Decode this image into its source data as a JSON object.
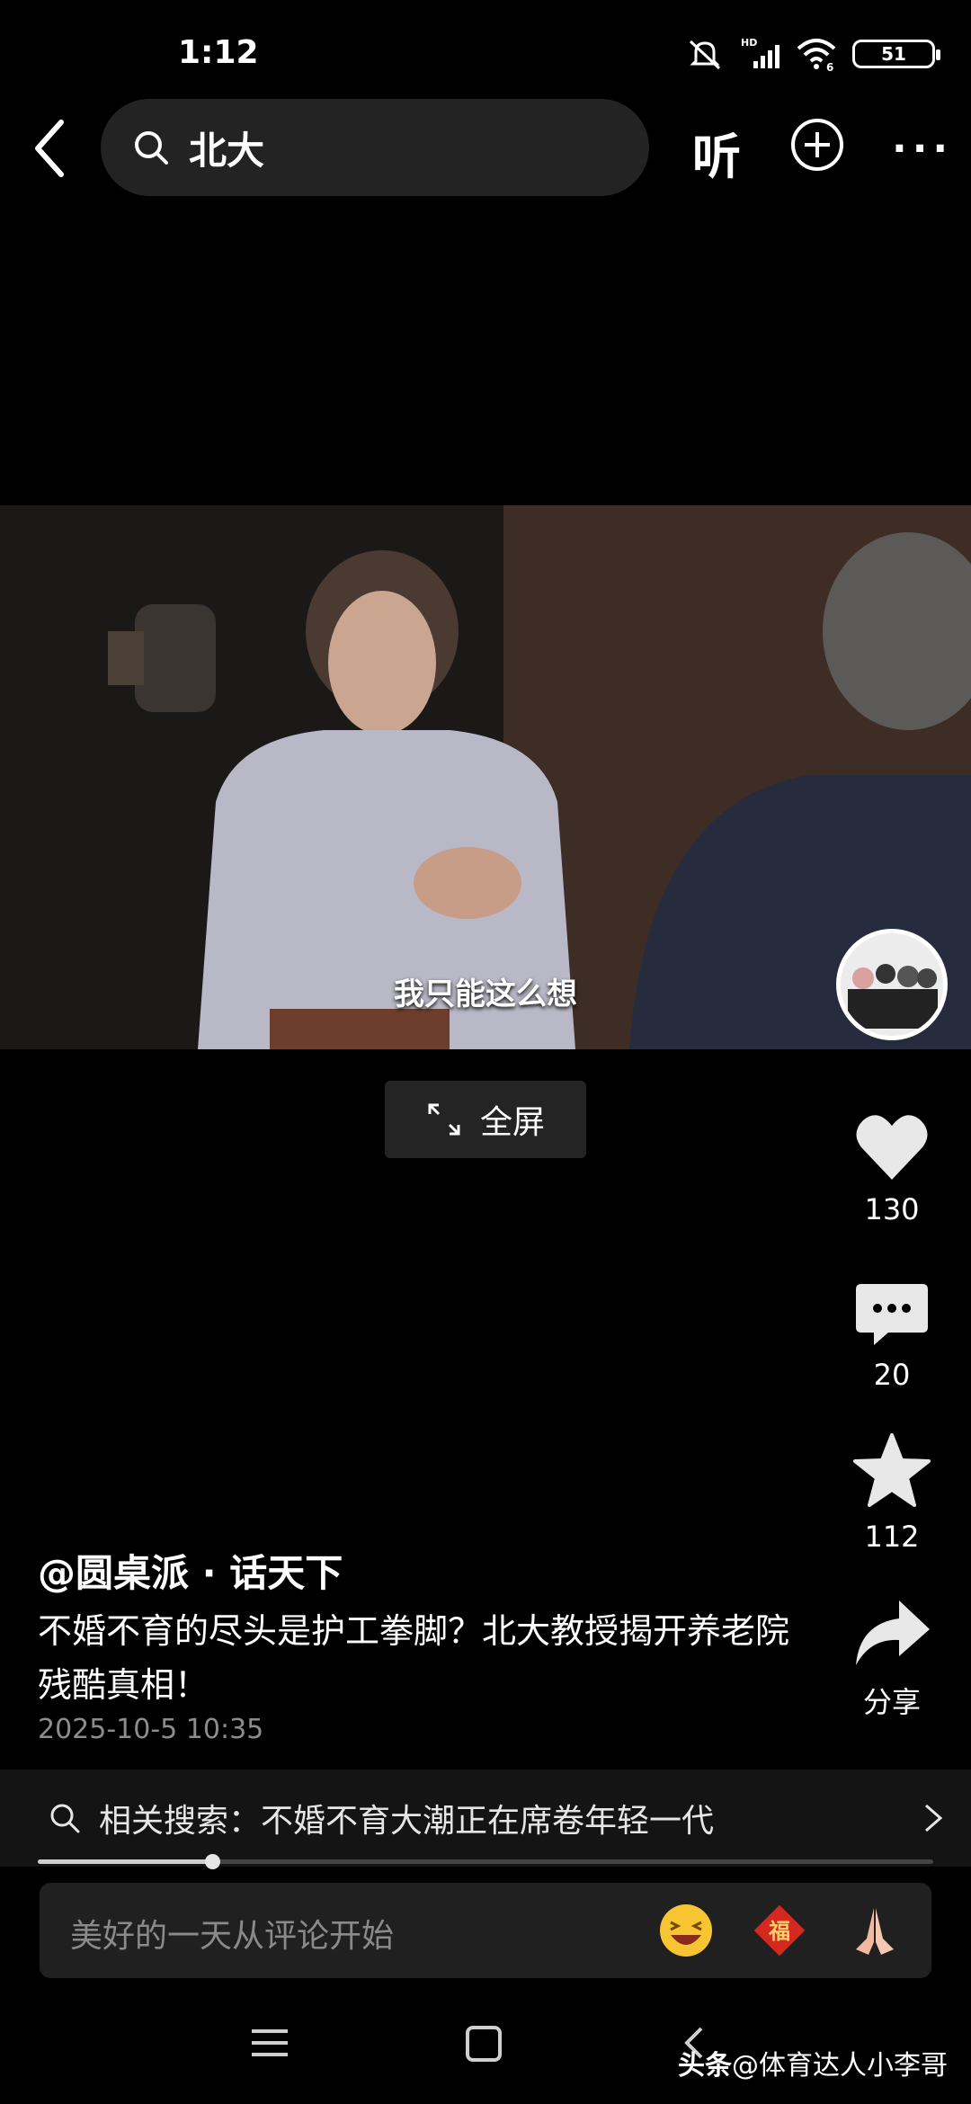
{
  "status_bar": {
    "time": "1:12",
    "network": "HD",
    "signal_sub": "6",
    "battery": "51"
  },
  "header": {
    "search_text": "北大",
    "listen_label": "听"
  },
  "video": {
    "subtitle": "我只能这么想"
  },
  "fullscreen_label": "全屏",
  "actions": {
    "likes": "130",
    "comments": "20",
    "favorites": "112",
    "share_label": "分享"
  },
  "post": {
    "author": "@圆桌派 · 话天下",
    "title": "不婚不育的尽头是护工拳脚？北大教授揭开养老院残酷真相！",
    "date": "2025-10-5 10:35"
  },
  "related": {
    "text": "相关搜索：不婚不育大潮正在席卷年轻一代"
  },
  "progress": {
    "played_fraction": 0.195
  },
  "comment": {
    "placeholder": "美好的一天从评论开始"
  },
  "watermark": {
    "brand": "头条",
    "handle": "@体育达人小李哥"
  },
  "colors": {
    "background": "#000000",
    "panel": "#202020",
    "muted_text": "#8c8c8c"
  }
}
